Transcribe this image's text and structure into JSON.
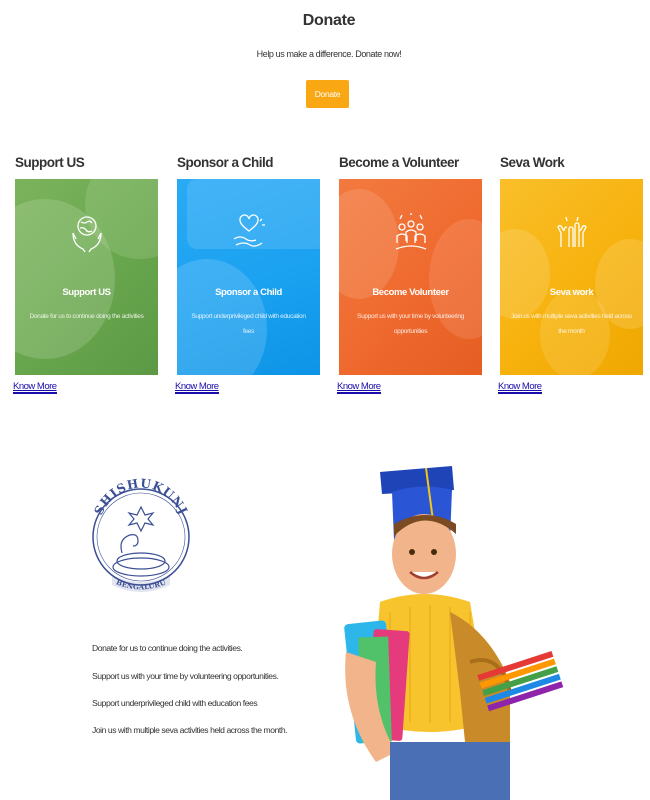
{
  "header": {
    "title": "Donate",
    "subtitle": "Help us make a difference. Donate now!",
    "donate_button": "Donate"
  },
  "cards": [
    {
      "heading": "Support US",
      "label": "Support US",
      "description": "Donate for us to continue doing the activities",
      "link": "Know More",
      "color": "#6aa84f",
      "icon": "globe-hands-icon"
    },
    {
      "heading": "Sponsor a Child",
      "label": "Sponsor a Child",
      "description": "Support underprivileged child with education fees",
      "link": "Know More",
      "color": "#1aa1f0",
      "icon": "hands-heart-icon"
    },
    {
      "heading": "Become a Volunteer",
      "label": "Become Volunteer",
      "description": "Support us with your time by volunteering opportunities",
      "link": "Know More",
      "color": "#ef6a2f",
      "icon": "volunteers-icon"
    },
    {
      "heading": "Seva Work",
      "label": "Seva work",
      "description": "Join us with multiple seva activities held across the month",
      "link": "Know More",
      "color": "#f7b20e",
      "icon": "raised-hands-icon"
    }
  ],
  "logo": {
    "top_text": "SHISHUKUNJ",
    "bottom_text": "BENGALURU",
    "color": "#3b4f95"
  },
  "info_lines": [
    "Donate for us to continue doing the activities.",
    "Support us with your time by volunteering opportunities.",
    "Support underprivileged child with education fees",
    "Join us with multiple seva activities held across the month."
  ]
}
